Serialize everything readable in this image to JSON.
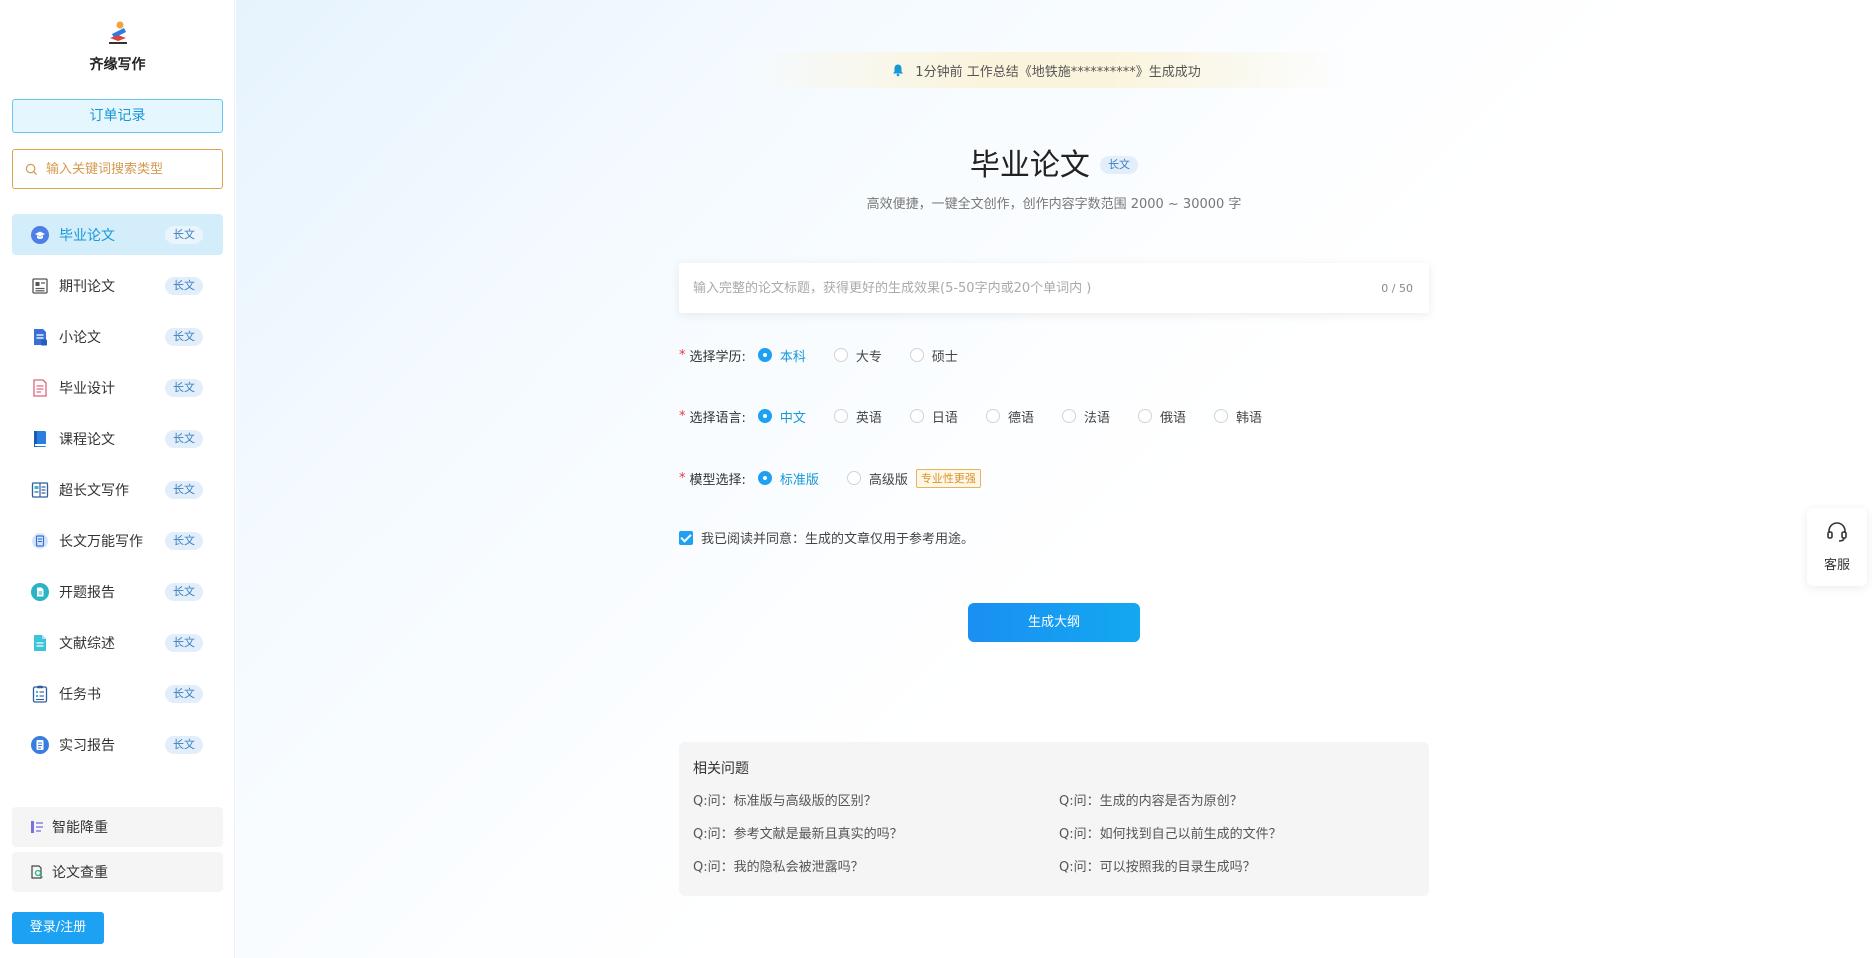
{
  "sidebar": {
    "brand": "齐缘写作",
    "order_button": "订单记录",
    "search_placeholder": "输入关键词搜索类型",
    "items": [
      {
        "label": "毕业论文",
        "tag": "长文",
        "icon": "graduation-cap-icon"
      },
      {
        "label": "期刊论文",
        "tag": "长文",
        "icon": "journal-icon"
      },
      {
        "label": "小论文",
        "tag": "长文",
        "icon": "document-icon"
      },
      {
        "label": "毕业设计",
        "tag": "长文",
        "icon": "design-doc-icon"
      },
      {
        "label": "课程论文",
        "tag": "长文",
        "icon": "book-icon"
      },
      {
        "label": "超长文写作",
        "tag": "长文",
        "icon": "long-text-icon"
      },
      {
        "label": "长文万能写作",
        "tag": "长文",
        "icon": "universal-write-icon"
      },
      {
        "label": "开题报告",
        "tag": "长文",
        "icon": "proposal-report-icon"
      },
      {
        "label": "文献综述",
        "tag": "长文",
        "icon": "literature-review-icon"
      },
      {
        "label": "任务书",
        "tag": "长文",
        "icon": "task-list-icon"
      },
      {
        "label": "实习报告",
        "tag": "长文",
        "icon": "internship-report-icon"
      }
    ],
    "tools": [
      {
        "label": "智能降重",
        "icon": "rewrite-icon"
      },
      {
        "label": "论文查重",
        "icon": "plagiarism-check-icon"
      }
    ],
    "login_button": "登录/注册"
  },
  "notice": {
    "text": "1分钟前 工作总结《地铁施**********》生成成功"
  },
  "main": {
    "title": "毕业论文",
    "title_tag": "长文",
    "subtitle": "高效便捷，一键全文创作，创作内容字数范围 2000 ~ 30000 字",
    "title_input_placeholder": "输入完整的论文标题，获得更好的生成效果(5-50字内或20个单词内 )",
    "title_input_counter": "0 / 50",
    "education": {
      "label": "选择学历:",
      "options": [
        "本科",
        "大专",
        "硕士"
      ],
      "selected": "本科"
    },
    "language": {
      "label": "选择语言:",
      "options": [
        "中文",
        "英语",
        "日语",
        "德语",
        "法语",
        "俄语",
        "韩语"
      ],
      "selected": "中文"
    },
    "model": {
      "label": "模型选择:",
      "options": [
        "标准版",
        "高级版"
      ],
      "selected": "标准版",
      "badge": "专业性更强"
    },
    "agreement": "我已阅读并同意：生成的文章仅用于参考用途。",
    "generate_button": "生成大纲",
    "faq": {
      "title": "相关问题",
      "items": [
        "Q:问：标准版与高级版的区别？",
        "Q:问：生成的内容是否为原创？",
        "Q:问：参考文献是最新且真实的吗？",
        "Q:问：如何找到自己以前生成的文件？",
        "Q:问：我的隐私会被泄露吗？",
        "Q:问：可以按照我的目录生成吗？"
      ]
    }
  },
  "service": {
    "label": "客服",
    "icon": "headset-icon"
  },
  "colors": {
    "accent": "#1da1f2",
    "accent_text": "#1698d8",
    "active_nav_bg": "#d4edfb",
    "search_border": "#e1a24d",
    "notice_bg": "#fbf4dc"
  }
}
